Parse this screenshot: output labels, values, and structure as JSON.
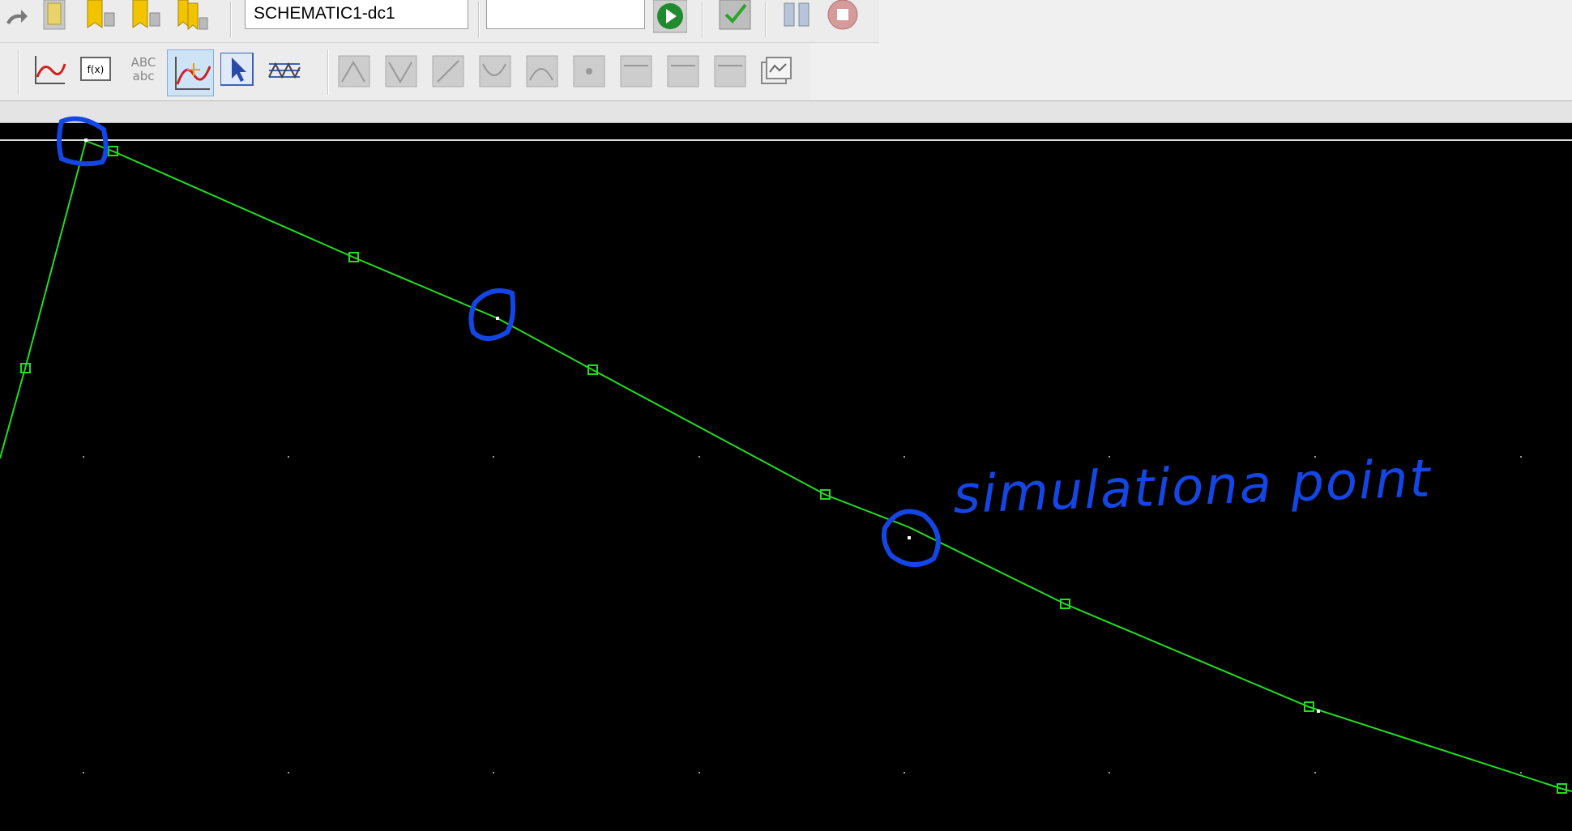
{
  "toolbar": {
    "profile_combo_value": "SCHEMATIC1-dc1",
    "secondary_combo_value": "",
    "buttons_row1": [
      {
        "name": "redo-icon"
      },
      {
        "name": "new-simulation-profile-icon"
      },
      {
        "name": "edit-profile-icon"
      },
      {
        "name": "marker-icon"
      },
      {
        "name": "multi-marker-icon"
      },
      {
        "name": "run-simulation-icon"
      },
      {
        "name": "view-output-icon"
      },
      {
        "name": "pause-icon"
      },
      {
        "name": "stop-icon"
      }
    ],
    "buttons_row2": [
      {
        "name": "add-trace-icon"
      },
      {
        "name": "eval-measurement-icon",
        "label": "f(x)"
      },
      {
        "name": "text-label-icon",
        "label_top": "ABC",
        "label_bottom": "abc"
      },
      {
        "name": "toggle-cursor-icon",
        "active": true
      },
      {
        "name": "select-pointer-icon"
      },
      {
        "name": "grid-toggle-icon"
      },
      {
        "name": "cursor-peak-icon"
      },
      {
        "name": "cursor-trough-icon"
      },
      {
        "name": "cursor-max-slope-icon"
      },
      {
        "name": "cursor-min-icon"
      },
      {
        "name": "cursor-max-icon"
      },
      {
        "name": "cursor-point-icon"
      },
      {
        "name": "cursor-search-icon"
      },
      {
        "name": "cursor-next-transition-icon"
      },
      {
        "name": "cursor-prev-transition-icon"
      },
      {
        "name": "display-info-icon"
      }
    ]
  },
  "colors": {
    "plot_background": "#000000",
    "trace": "#22dd22",
    "annotation": "#1446e6",
    "toolbar": "#ececec"
  },
  "annotation": {
    "text": "simulationa point"
  }
}
